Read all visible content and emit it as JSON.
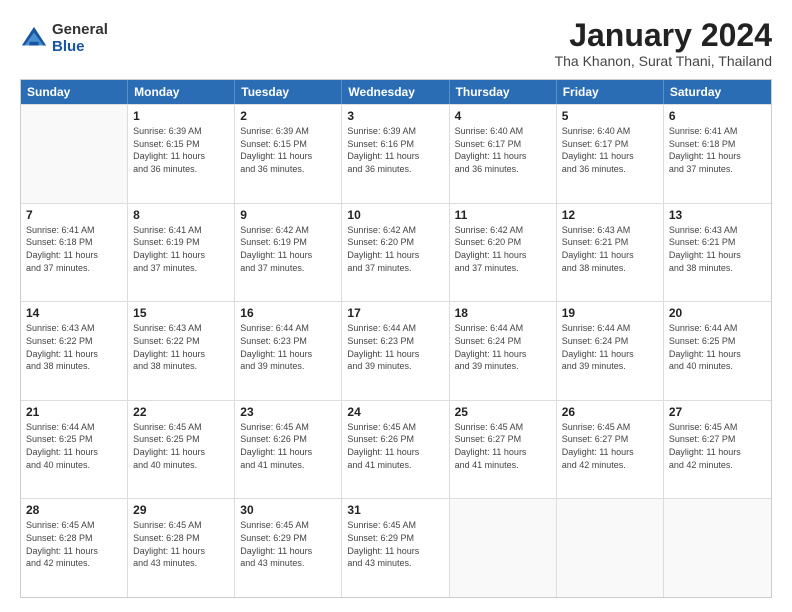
{
  "logo": {
    "general": "General",
    "blue": "Blue"
  },
  "title": "January 2024",
  "subtitle": "Tha Khanon, Surat Thani, Thailand",
  "header_days": [
    "Sunday",
    "Monday",
    "Tuesday",
    "Wednesday",
    "Thursday",
    "Friday",
    "Saturday"
  ],
  "weeks": [
    [
      {
        "day": "",
        "info": "",
        "empty": true
      },
      {
        "day": "1",
        "info": "Sunrise: 6:39 AM\nSunset: 6:15 PM\nDaylight: 11 hours\nand 36 minutes."
      },
      {
        "day": "2",
        "info": "Sunrise: 6:39 AM\nSunset: 6:15 PM\nDaylight: 11 hours\nand 36 minutes."
      },
      {
        "day": "3",
        "info": "Sunrise: 6:39 AM\nSunset: 6:16 PM\nDaylight: 11 hours\nand 36 minutes."
      },
      {
        "day": "4",
        "info": "Sunrise: 6:40 AM\nSunset: 6:17 PM\nDaylight: 11 hours\nand 36 minutes."
      },
      {
        "day": "5",
        "info": "Sunrise: 6:40 AM\nSunset: 6:17 PM\nDaylight: 11 hours\nand 36 minutes."
      },
      {
        "day": "6",
        "info": "Sunrise: 6:41 AM\nSunset: 6:18 PM\nDaylight: 11 hours\nand 37 minutes."
      }
    ],
    [
      {
        "day": "7",
        "info": "Sunrise: 6:41 AM\nSunset: 6:18 PM\nDaylight: 11 hours\nand 37 minutes."
      },
      {
        "day": "8",
        "info": "Sunrise: 6:41 AM\nSunset: 6:19 PM\nDaylight: 11 hours\nand 37 minutes."
      },
      {
        "day": "9",
        "info": "Sunrise: 6:42 AM\nSunset: 6:19 PM\nDaylight: 11 hours\nand 37 minutes."
      },
      {
        "day": "10",
        "info": "Sunrise: 6:42 AM\nSunset: 6:20 PM\nDaylight: 11 hours\nand 37 minutes."
      },
      {
        "day": "11",
        "info": "Sunrise: 6:42 AM\nSunset: 6:20 PM\nDaylight: 11 hours\nand 37 minutes."
      },
      {
        "day": "12",
        "info": "Sunrise: 6:43 AM\nSunset: 6:21 PM\nDaylight: 11 hours\nand 38 minutes."
      },
      {
        "day": "13",
        "info": "Sunrise: 6:43 AM\nSunset: 6:21 PM\nDaylight: 11 hours\nand 38 minutes."
      }
    ],
    [
      {
        "day": "14",
        "info": "Sunrise: 6:43 AM\nSunset: 6:22 PM\nDaylight: 11 hours\nand 38 minutes."
      },
      {
        "day": "15",
        "info": "Sunrise: 6:43 AM\nSunset: 6:22 PM\nDaylight: 11 hours\nand 38 minutes."
      },
      {
        "day": "16",
        "info": "Sunrise: 6:44 AM\nSunset: 6:23 PM\nDaylight: 11 hours\nand 39 minutes."
      },
      {
        "day": "17",
        "info": "Sunrise: 6:44 AM\nSunset: 6:23 PM\nDaylight: 11 hours\nand 39 minutes."
      },
      {
        "day": "18",
        "info": "Sunrise: 6:44 AM\nSunset: 6:24 PM\nDaylight: 11 hours\nand 39 minutes."
      },
      {
        "day": "19",
        "info": "Sunrise: 6:44 AM\nSunset: 6:24 PM\nDaylight: 11 hours\nand 39 minutes."
      },
      {
        "day": "20",
        "info": "Sunrise: 6:44 AM\nSunset: 6:25 PM\nDaylight: 11 hours\nand 40 minutes."
      }
    ],
    [
      {
        "day": "21",
        "info": "Sunrise: 6:44 AM\nSunset: 6:25 PM\nDaylight: 11 hours\nand 40 minutes."
      },
      {
        "day": "22",
        "info": "Sunrise: 6:45 AM\nSunset: 6:25 PM\nDaylight: 11 hours\nand 40 minutes."
      },
      {
        "day": "23",
        "info": "Sunrise: 6:45 AM\nSunset: 6:26 PM\nDaylight: 11 hours\nand 41 minutes."
      },
      {
        "day": "24",
        "info": "Sunrise: 6:45 AM\nSunset: 6:26 PM\nDaylight: 11 hours\nand 41 minutes."
      },
      {
        "day": "25",
        "info": "Sunrise: 6:45 AM\nSunset: 6:27 PM\nDaylight: 11 hours\nand 41 minutes."
      },
      {
        "day": "26",
        "info": "Sunrise: 6:45 AM\nSunset: 6:27 PM\nDaylight: 11 hours\nand 42 minutes."
      },
      {
        "day": "27",
        "info": "Sunrise: 6:45 AM\nSunset: 6:27 PM\nDaylight: 11 hours\nand 42 minutes."
      }
    ],
    [
      {
        "day": "28",
        "info": "Sunrise: 6:45 AM\nSunset: 6:28 PM\nDaylight: 11 hours\nand 42 minutes."
      },
      {
        "day": "29",
        "info": "Sunrise: 6:45 AM\nSunset: 6:28 PM\nDaylight: 11 hours\nand 43 minutes."
      },
      {
        "day": "30",
        "info": "Sunrise: 6:45 AM\nSunset: 6:29 PM\nDaylight: 11 hours\nand 43 minutes."
      },
      {
        "day": "31",
        "info": "Sunrise: 6:45 AM\nSunset: 6:29 PM\nDaylight: 11 hours\nand 43 minutes."
      },
      {
        "day": "",
        "info": "",
        "empty": true
      },
      {
        "day": "",
        "info": "",
        "empty": true
      },
      {
        "day": "",
        "info": "",
        "empty": true
      }
    ]
  ]
}
